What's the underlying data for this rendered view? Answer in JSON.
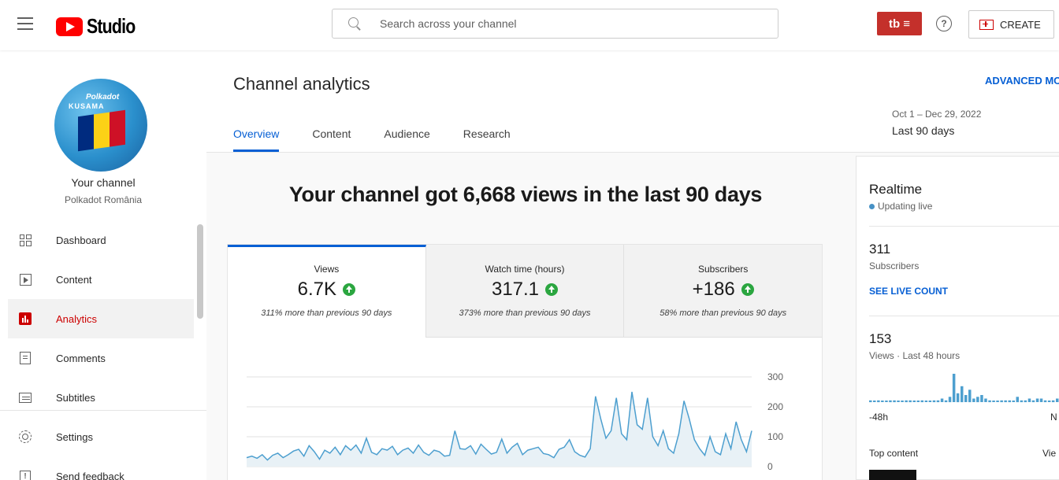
{
  "header": {
    "logo_text": "Studio",
    "search_placeholder": "Search across your channel",
    "tb_label": "tb ≡",
    "help_label": "?",
    "create_label": "CREATE"
  },
  "sidebar": {
    "avatar": {
      "line1": "Polkadot",
      "line2": "KUSAMA",
      "flag_colors": [
        "#002b7f",
        "#fcd116",
        "#ce1126"
      ]
    },
    "channel_title": "Your channel",
    "channel_name": "Polkadot România",
    "items": [
      {
        "label": "Dashboard",
        "icon": "dashboard-icon"
      },
      {
        "label": "Content",
        "icon": "content-icon"
      },
      {
        "label": "Analytics",
        "icon": "analytics-icon",
        "active": true
      },
      {
        "label": "Comments",
        "icon": "comments-icon"
      },
      {
        "label": "Subtitles",
        "icon": "subtitles-icon"
      },
      {
        "label": "Settings",
        "icon": "gear-icon"
      },
      {
        "label": "Send feedback",
        "icon": "feedback-icon"
      }
    ]
  },
  "main": {
    "title": "Channel analytics",
    "advanced_mode": "ADVANCED MO",
    "tabs": [
      "Overview",
      "Content",
      "Audience",
      "Research"
    ],
    "date_range": "Oct 1 – Dec 29, 2022",
    "date_label": "Last 90 days",
    "headline": "Your channel got 6,668 views in the last 90 days",
    "metrics": [
      {
        "label": "Views",
        "value": "6.7K",
        "note": "311% more than previous 90 days"
      },
      {
        "label": "Watch time (hours)",
        "value": "317.1",
        "note": "373% more than previous 90 days"
      },
      {
        "label": "Subscribers",
        "value": "+186",
        "note": "58% more than previous 90 days"
      }
    ]
  },
  "chart_data": {
    "type": "area",
    "title": "",
    "ylim": [
      0,
      300
    ],
    "yticks": [
      "0",
      "100",
      "200",
      "300"
    ],
    "x_range": [
      "Oct 1, 2022",
      "Dec 29, 2022"
    ],
    "series": [
      {
        "values": [
          30,
          35,
          28,
          40,
          22,
          38,
          45,
          30,
          40,
          52,
          58,
          35,
          70,
          50,
          25,
          55,
          45,
          65,
          40,
          70,
          55,
          72,
          45,
          95,
          48,
          40,
          60,
          55,
          68,
          40,
          55,
          62,
          45,
          72,
          48,
          38,
          55,
          50,
          35,
          38,
          120,
          60,
          58,
          70,
          42,
          75,
          58,
          42,
          48,
          92,
          45,
          65,
          78,
          40,
          55,
          60,
          65,
          44,
          40,
          30,
          58,
          65,
          90,
          50,
          38,
          32,
          60,
          235,
          160,
          95,
          120,
          230,
          110,
          90,
          250,
          140,
          125,
          230,
          100,
          70,
          120,
          60,
          45,
          110,
          220,
          160,
          90,
          60,
          38,
          100,
          50,
          40,
          110,
          60,
          150,
          90,
          50,
          120
        ]
      }
    ],
    "color": "#4d9fcf"
  },
  "realtime": {
    "title": "Realtime",
    "live": "Updating live",
    "subscribers": "311",
    "subscribers_label": "Subscribers",
    "see_live": "SEE LIVE COUNT",
    "views": "153",
    "views_label": "Views · Last 48 hours",
    "axis_left": "-48h",
    "axis_right": "N",
    "top_content": "Top content",
    "views_col": "Vie",
    "bars": [
      1,
      0,
      1,
      0,
      0,
      1,
      1,
      0,
      0,
      1,
      1,
      0,
      0,
      1,
      0,
      0,
      1,
      1,
      2,
      1,
      3,
      16,
      5,
      9,
      4,
      7,
      2,
      3,
      4,
      2,
      1,
      0,
      0,
      1,
      1,
      1,
      0,
      3,
      1,
      1,
      2,
      1,
      2,
      2,
      1,
      0,
      1,
      2
    ]
  }
}
